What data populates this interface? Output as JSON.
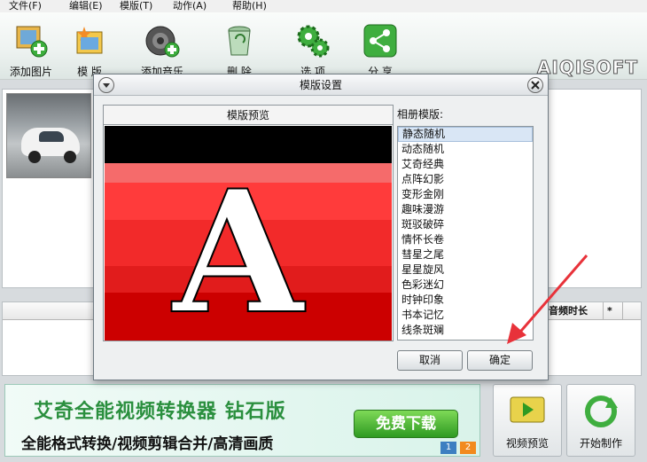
{
  "menu": {
    "file": "文件(F)",
    "edit": "编辑(E)",
    "template": "模版(T)",
    "action": "动作(A)",
    "help": "帮助(H)"
  },
  "toolbar": {
    "add_picture": "添加图片",
    "template": "模 版",
    "add_music": "添加音乐",
    "delete": "删 除",
    "options": "选 项",
    "share": "分 享",
    "brand": "AIQISOFT"
  },
  "list": {
    "col_audio_duration": "音频时长",
    "col_star": "*"
  },
  "banner": {
    "title": "艾奇全能视频转换器 钻石版",
    "subtitle": "全能格式转换/视频剪辑合并/高清画质",
    "download": "免费下载",
    "page1": "1",
    "page2": "2"
  },
  "bottom_buttons": {
    "preview": "视频预览",
    "start": "开始制作"
  },
  "dialog": {
    "title": "模版设置",
    "preview_header": "模版预览",
    "preview_letter": "A",
    "list_label": "相册模版:",
    "templates": [
      "静态随机",
      "动态随机",
      "艾奇经典",
      "点阵幻影",
      "变形金刚",
      "趣味漫游",
      "斑驳破碎",
      "情怀长卷",
      "彗星之尾",
      "星星旋风",
      "色彩迷幻",
      "时钟印象",
      "书本记忆",
      "线条斑斓"
    ],
    "selected_index": 0,
    "cancel": "取消",
    "ok": "确定"
  },
  "colors": {
    "banner_green": "#2a8f3e",
    "arrow_red": "#e8323a",
    "preview_stripes": [
      "#000000",
      "#f56b6b",
      "#ff3b3b",
      "#f22a2a",
      "#e11c1c",
      "#cc0000"
    ]
  }
}
